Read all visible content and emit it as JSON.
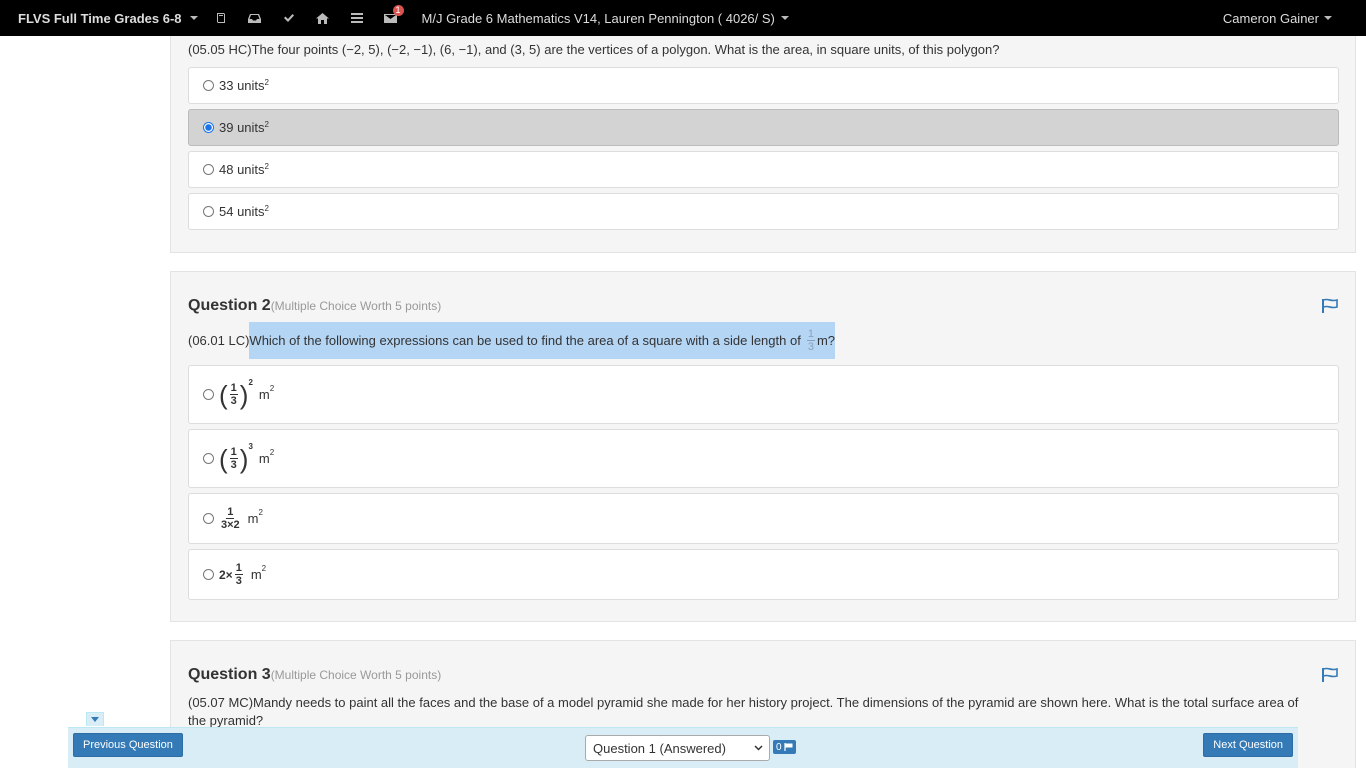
{
  "navbar": {
    "brand": "FLVS Full Time Grades 6-8",
    "notification_count": "1",
    "course": "M/J Grade 6 Mathematics V14, Lauren Pennington ( 4026/ S)",
    "user": "Cameron Gainer",
    "icons": [
      "book-icon",
      "inbox-icon",
      "check-icon",
      "home-icon",
      "menu-icon",
      "mail-icon"
    ]
  },
  "question1": {
    "text": "(05.05 HC)The four points (−2, 5), (−2, −1), (6, −1), and (3, 5) are the vertices of a polygon. What is the area, in square units, of this polygon?",
    "options": [
      {
        "label": "33 units",
        "sup": "2",
        "selected": false
      },
      {
        "label": "39 units",
        "sup": "2",
        "selected": true
      },
      {
        "label": "48 units",
        "sup": "2",
        "selected": false
      },
      {
        "label": "54 units",
        "sup": "2",
        "selected": false
      }
    ]
  },
  "question2": {
    "title": "Question 2",
    "worth": "(Multiple Choice Worth 5 points)",
    "prefix": "(06.01 LC)",
    "text": "Which of the following expressions can be used to find the area of a square with a side length of",
    "frac_num": "1",
    "frac_den": "3",
    "suffix": " m?",
    "options": [
      {
        "num": "1",
        "den": "3",
        "exp": "2",
        "unit": "m",
        "unit_sup": "2"
      },
      {
        "num": "1",
        "den": "3",
        "exp": "3",
        "unit": "m",
        "unit_sup": "2"
      },
      {
        "num": "1",
        "den": "3×2",
        "unit": "m",
        "unit_sup": "2"
      },
      {
        "pre": "2×",
        "num": "1",
        "den": "3",
        "unit": "m",
        "unit_sup": "2"
      }
    ]
  },
  "question3": {
    "title": "Question 3",
    "worth": "(Multiple Choice Worth 5 points)",
    "text": "(05.07 MC)Mandy needs to paint all the faces and the base of a model pyramid she made for her history project. The dimensions of the pyramid are shown here. What is the total surface area of the pyramid?"
  },
  "footer": {
    "prev": "Previous Question",
    "next": "Next Question",
    "select_value": "Question 1 (Answered)",
    "flag_count": "0"
  },
  "colors": {
    "navbar": "#000000",
    "primary": "#337ab7",
    "highlight": "#b5d5f4",
    "bar": "#d9edf7"
  }
}
